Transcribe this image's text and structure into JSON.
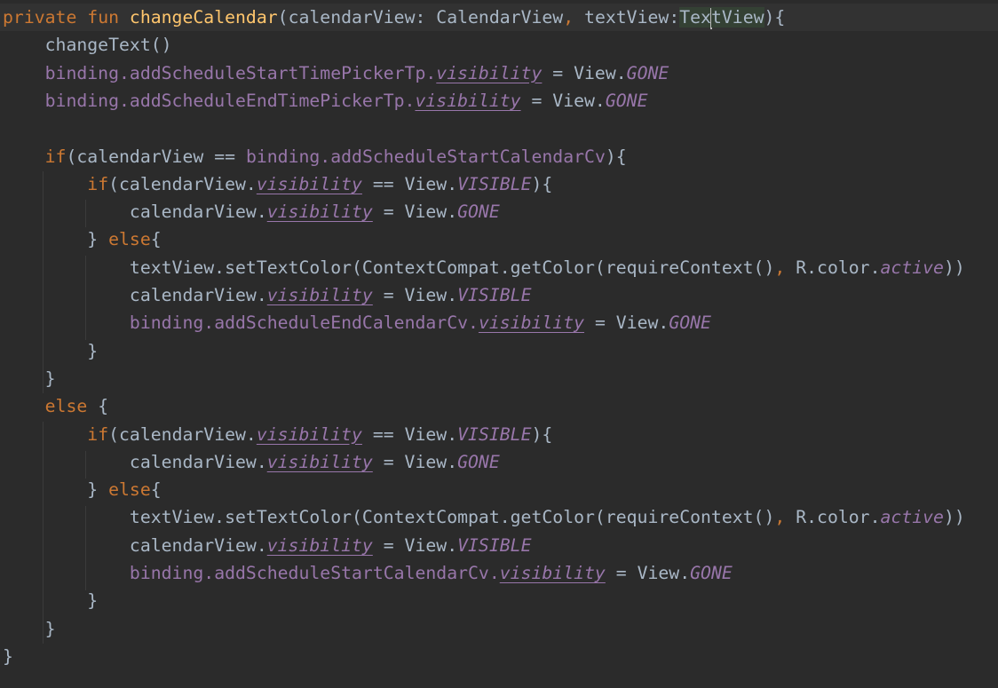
{
  "editor": {
    "lines": [
      [
        {
          "t": "private ",
          "c": "kw"
        },
        {
          "t": "fun ",
          "c": "kw"
        },
        {
          "t": "changeCalendar",
          "c": "fn"
        },
        {
          "t": "(calendarView: CalendarView",
          "c": "punc"
        },
        {
          "t": ", ",
          "c": "comma"
        },
        {
          "t": "textView:",
          "c": "punc"
        },
        {
          "t": "Tex",
          "c": "punc",
          "h": true
        },
        {
          "caret": true
        },
        {
          "t": "tView",
          "c": "punc",
          "h": true
        },
        {
          "t": "){",
          "c": "punc"
        }
      ],
      [
        {
          "t": "    changeText()",
          "c": "punc"
        }
      ],
      [
        {
          "t": "    ",
          "c": "punc"
        },
        {
          "t": "binding.addScheduleStartTimePickerTp.",
          "c": "prop"
        },
        {
          "t": "visibility",
          "c": "prop-iu"
        },
        {
          "t": " = View.",
          "c": "punc"
        },
        {
          "t": "GONE",
          "c": "const"
        }
      ],
      [
        {
          "t": "    ",
          "c": "punc"
        },
        {
          "t": "binding.addScheduleEndTimePickerTp.",
          "c": "prop"
        },
        {
          "t": "visibility",
          "c": "prop-iu"
        },
        {
          "t": " = View.",
          "c": "punc"
        },
        {
          "t": "GONE",
          "c": "const"
        }
      ],
      [],
      [
        {
          "t": "    ",
          "c": "punc"
        },
        {
          "t": "if",
          "c": "kw"
        },
        {
          "t": "(calendarView == ",
          "c": "punc"
        },
        {
          "t": "binding.addScheduleStartCalendarCv",
          "c": "prop"
        },
        {
          "t": "){",
          "c": "punc"
        }
      ],
      [
        {
          "t": "        ",
          "c": "punc"
        },
        {
          "t": "if",
          "c": "kw"
        },
        {
          "t": "(calendarView.",
          "c": "punc"
        },
        {
          "t": "visibility",
          "c": "prop-iu"
        },
        {
          "t": " == View.",
          "c": "punc"
        },
        {
          "t": "VISIBLE",
          "c": "const"
        },
        {
          "t": "){",
          "c": "punc"
        }
      ],
      [
        {
          "t": "            calendarView.",
          "c": "punc"
        },
        {
          "t": "visibility",
          "c": "prop-iu"
        },
        {
          "t": " = View.",
          "c": "punc"
        },
        {
          "t": "GONE",
          "c": "const"
        }
      ],
      [
        {
          "t": "        } ",
          "c": "punc"
        },
        {
          "t": "else",
          "c": "kw"
        },
        {
          "t": "{",
          "c": "punc"
        }
      ],
      [
        {
          "t": "            textView.setTextColor(ContextCompat.getColor(requireContext()",
          "c": "punc"
        },
        {
          "t": ", ",
          "c": "comma"
        },
        {
          "t": "R.color.",
          "c": "punc"
        },
        {
          "t": "active",
          "c": "const"
        },
        {
          "t": "))",
          "c": "punc"
        }
      ],
      [
        {
          "t": "            calendarView.",
          "c": "punc"
        },
        {
          "t": "visibility",
          "c": "prop-iu"
        },
        {
          "t": " = View.",
          "c": "punc"
        },
        {
          "t": "VISIBLE",
          "c": "const"
        }
      ],
      [
        {
          "t": "            ",
          "c": "punc"
        },
        {
          "t": "binding.addScheduleEndCalendarCv.",
          "c": "prop"
        },
        {
          "t": "visibility",
          "c": "prop-iu"
        },
        {
          "t": " = View.",
          "c": "punc"
        },
        {
          "t": "GONE",
          "c": "const"
        }
      ],
      [
        {
          "t": "        }",
          "c": "punc"
        }
      ],
      [
        {
          "t": "    }",
          "c": "punc"
        }
      ],
      [
        {
          "t": "    ",
          "c": "punc"
        },
        {
          "t": "else ",
          "c": "kw"
        },
        {
          "t": "{",
          "c": "punc"
        }
      ],
      [
        {
          "t": "        ",
          "c": "punc"
        },
        {
          "t": "if",
          "c": "kw"
        },
        {
          "t": "(calendarView.",
          "c": "punc"
        },
        {
          "t": "visibility",
          "c": "prop-iu"
        },
        {
          "t": " == View.",
          "c": "punc"
        },
        {
          "t": "VISIBLE",
          "c": "const"
        },
        {
          "t": "){",
          "c": "punc"
        }
      ],
      [
        {
          "t": "            calendarView.",
          "c": "punc"
        },
        {
          "t": "visibility",
          "c": "prop-iu"
        },
        {
          "t": " = View.",
          "c": "punc"
        },
        {
          "t": "GONE",
          "c": "const"
        }
      ],
      [
        {
          "t": "        } ",
          "c": "punc"
        },
        {
          "t": "else",
          "c": "kw"
        },
        {
          "t": "{",
          "c": "punc"
        }
      ],
      [
        {
          "t": "            textView.setTextColor(ContextCompat.getColor(requireContext()",
          "c": "punc"
        },
        {
          "t": ", ",
          "c": "comma"
        },
        {
          "t": "R.color.",
          "c": "punc"
        },
        {
          "t": "active",
          "c": "const"
        },
        {
          "t": "))",
          "c": "punc"
        }
      ],
      [
        {
          "t": "            calendarView.",
          "c": "punc"
        },
        {
          "t": "visibility",
          "c": "prop-iu"
        },
        {
          "t": " = View.",
          "c": "punc"
        },
        {
          "t": "VISIBLE",
          "c": "const"
        }
      ],
      [
        {
          "t": "            ",
          "c": "punc"
        },
        {
          "t": "binding.addScheduleStartCalendarCv.",
          "c": "prop"
        },
        {
          "t": "visibility",
          "c": "prop-iu"
        },
        {
          "t": " = View.",
          "c": "punc"
        },
        {
          "t": "GONE",
          "c": "const"
        }
      ],
      [
        {
          "t": "        }",
          "c": "punc"
        }
      ],
      [
        {
          "t": "    }",
          "c": "punc"
        }
      ],
      [
        {
          "t": "}",
          "c": "punc"
        }
      ]
    ]
  },
  "colors": {
    "background": "#2b2b2b",
    "current_line": "#323232",
    "keyword": "#cc7832",
    "function": "#ffc66d",
    "property": "#9876aa",
    "text": "#a9b7c6",
    "usage_highlight": "#344134"
  }
}
